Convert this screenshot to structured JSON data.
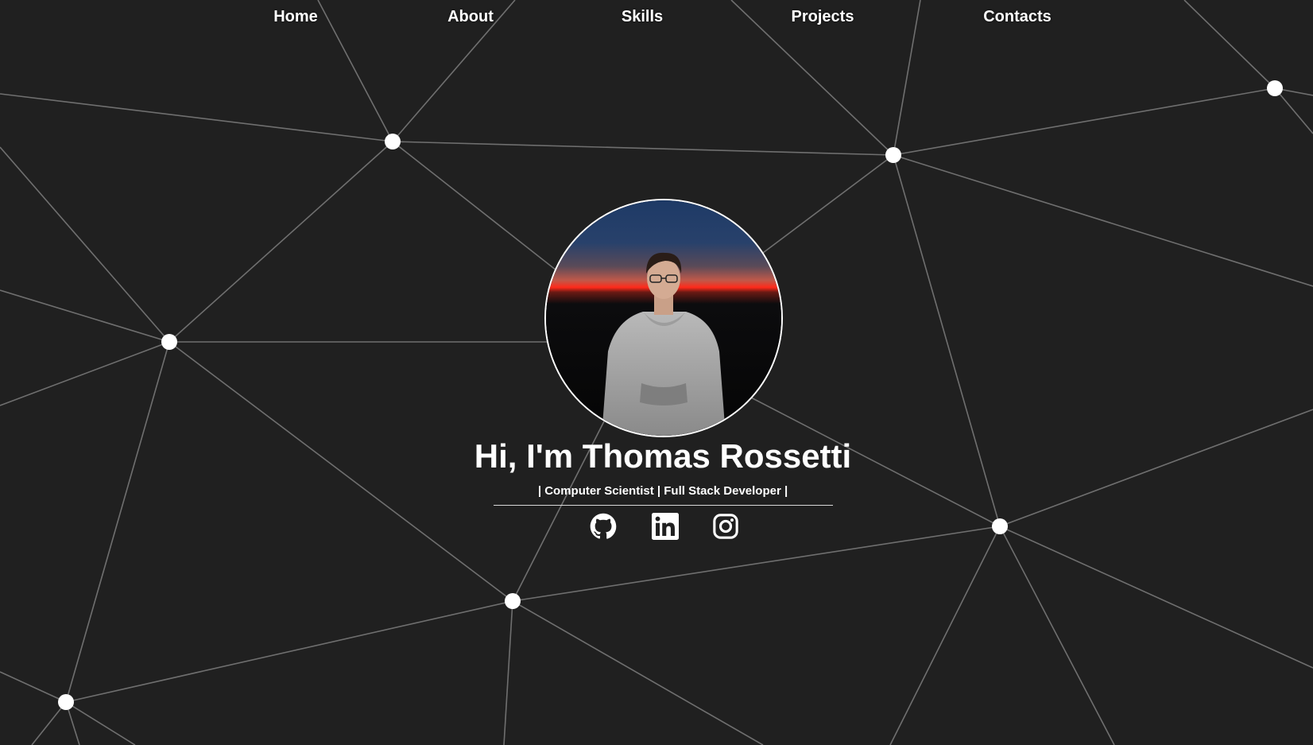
{
  "nav": {
    "items": [
      {
        "label": "Home"
      },
      {
        "label": "About"
      },
      {
        "label": "Skills"
      },
      {
        "label": "Projects"
      },
      {
        "label": "Contacts"
      }
    ]
  },
  "hero": {
    "title": "Hi, I'm Thomas Rossetti",
    "subtitle": "| Computer Scientist | Full Stack Developer |",
    "avatar_icon": "profile-photo"
  },
  "social": [
    {
      "icon": "github-icon"
    },
    {
      "icon": "linkedin-icon"
    },
    {
      "icon": "instagram-icon"
    }
  ],
  "colors": {
    "background": "#202020",
    "accent": "#ffffff",
    "network_line": "#6f6f6f"
  }
}
